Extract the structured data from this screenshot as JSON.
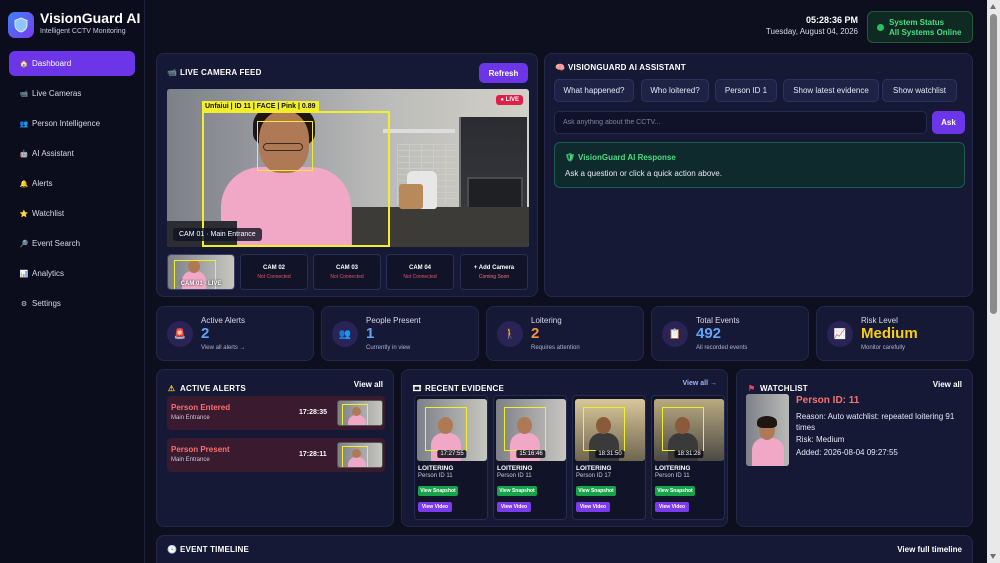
{
  "brand": {
    "title": "VisionGuard AI",
    "subtitle": "Intelligent CCTV Monitoring"
  },
  "nav": [
    {
      "label": "Dashboard",
      "icon": "🏠",
      "icon_name": "home-icon",
      "active": true
    },
    {
      "label": "Live Cameras",
      "icon": "📹",
      "icon_name": "camera-icon",
      "active": false
    },
    {
      "label": "Person Intelligence",
      "icon": "👥",
      "icon_name": "people-icon",
      "active": false
    },
    {
      "label": "AI Assistant",
      "icon": "🤖",
      "icon_name": "robot-icon",
      "active": false
    },
    {
      "label": "Alerts",
      "icon": "🔔",
      "icon_name": "bell-icon",
      "active": false
    },
    {
      "label": "Watchlist",
      "icon": "⭐",
      "icon_name": "star-icon",
      "active": false
    },
    {
      "label": "Event Search",
      "icon": "🔎",
      "icon_name": "search-icon",
      "active": false
    },
    {
      "label": "Analytics",
      "icon": "📊",
      "icon_name": "chart-icon",
      "active": false
    },
    {
      "label": "Settings",
      "icon": "⚙",
      "icon_name": "gear-icon",
      "active": false
    }
  ],
  "header": {
    "time": "05:28:36 PM",
    "date": "Tuesday, August 04, 2026",
    "status_line1": "System Status",
    "status_line2": "All Systems Online"
  },
  "live_feed": {
    "title": "LIVE CAMERA FEED",
    "refresh_label": "Refresh",
    "detection_label": "Unfaiui | ID 11 | FACE | Pink | 0.89",
    "live_badge": "● LIVE",
    "camera_label": "CAM 01 · Main Entrance",
    "thumbs": [
      {
        "name": "CAM 01 · LIVE",
        "status": ""
      },
      {
        "name": "CAM 02",
        "status": "Not Connected"
      },
      {
        "name": "CAM 03",
        "status": "Not Connected"
      },
      {
        "name": "CAM 04",
        "status": "Not Connected"
      },
      {
        "name": "+ Add Camera",
        "status": "Coming Soon"
      }
    ]
  },
  "assistant": {
    "title": "VISIONGUARD AI ASSISTANT",
    "chips": [
      "What happened?",
      "Who loitered?",
      "Person ID 1",
      "Show latest evidence",
      "Show watchlist"
    ],
    "input_placeholder": "Ask anything about the CCTV...",
    "ask_label": "Ask",
    "response_title": "VisionGuard AI Response",
    "response_body": "Ask a question or click a quick action above."
  },
  "stats": [
    {
      "label": "Active Alerts",
      "value": "2",
      "sub": "View all alerts →",
      "icon": "🚨",
      "icon_name": "siren-icon",
      "value_color": "#60a5fa"
    },
    {
      "label": "People Present",
      "value": "1",
      "sub": "Currently in view",
      "icon": "👥",
      "icon_name": "people-icon",
      "value_color": "#60a5fa"
    },
    {
      "label": "Loitering",
      "value": "2",
      "sub": "Requires attention",
      "icon": "🚶",
      "icon_name": "walking-icon",
      "value_color": "#fb923c"
    },
    {
      "label": "Total Events",
      "value": "492",
      "sub": "All recorded events",
      "icon": "📋",
      "icon_name": "clipboard-icon",
      "value_color": "#60a5fa"
    },
    {
      "label": "Risk Level",
      "value": "Medium",
      "sub": "Monitor carefully",
      "icon": "📈",
      "icon_name": "trend-icon",
      "value_color": "#facc15"
    }
  ],
  "alerts": {
    "title": "ACTIVE ALERTS",
    "view_all": "View all",
    "items": [
      {
        "title": "Person Entered",
        "location": "Main Entrance",
        "time": "17:28:35"
      },
      {
        "title": "Person Present",
        "location": "Main Entrance",
        "time": "17:28:11"
      }
    ]
  },
  "evidence": {
    "title": "RECENT EVIDENCE",
    "view_all": "View all →",
    "items": [
      {
        "time": "17:27:55",
        "type": "LOITERING",
        "person": "Person ID 11",
        "snapshot": "View Snapshot",
        "video": "View Video"
      },
      {
        "time": "15:16:46",
        "type": "LOITERING",
        "person": "Person ID 11",
        "snapshot": "View Snapshot",
        "video": "View Video"
      },
      {
        "time": "18:31:50",
        "type": "LOITERING",
        "person": "Person ID 17",
        "snapshot": "View Snapshot",
        "video": "View Video"
      },
      {
        "time": "18:31:28",
        "type": "LOITERING",
        "person": "Person ID 11",
        "snapshot": "View Snapshot",
        "video": "View Video"
      }
    ]
  },
  "watchlist": {
    "title": "WATCHLIST",
    "view_all": "View all",
    "person": "Person ID: 11",
    "reason": "Reason: Auto watchlist: repeated loitering 91 times",
    "risk": "Risk: Medium",
    "added": "Added: 2026-08-04 09:27:55"
  },
  "timeline": {
    "title": "EVENT TIMELINE",
    "view_full": "View full timeline"
  }
}
